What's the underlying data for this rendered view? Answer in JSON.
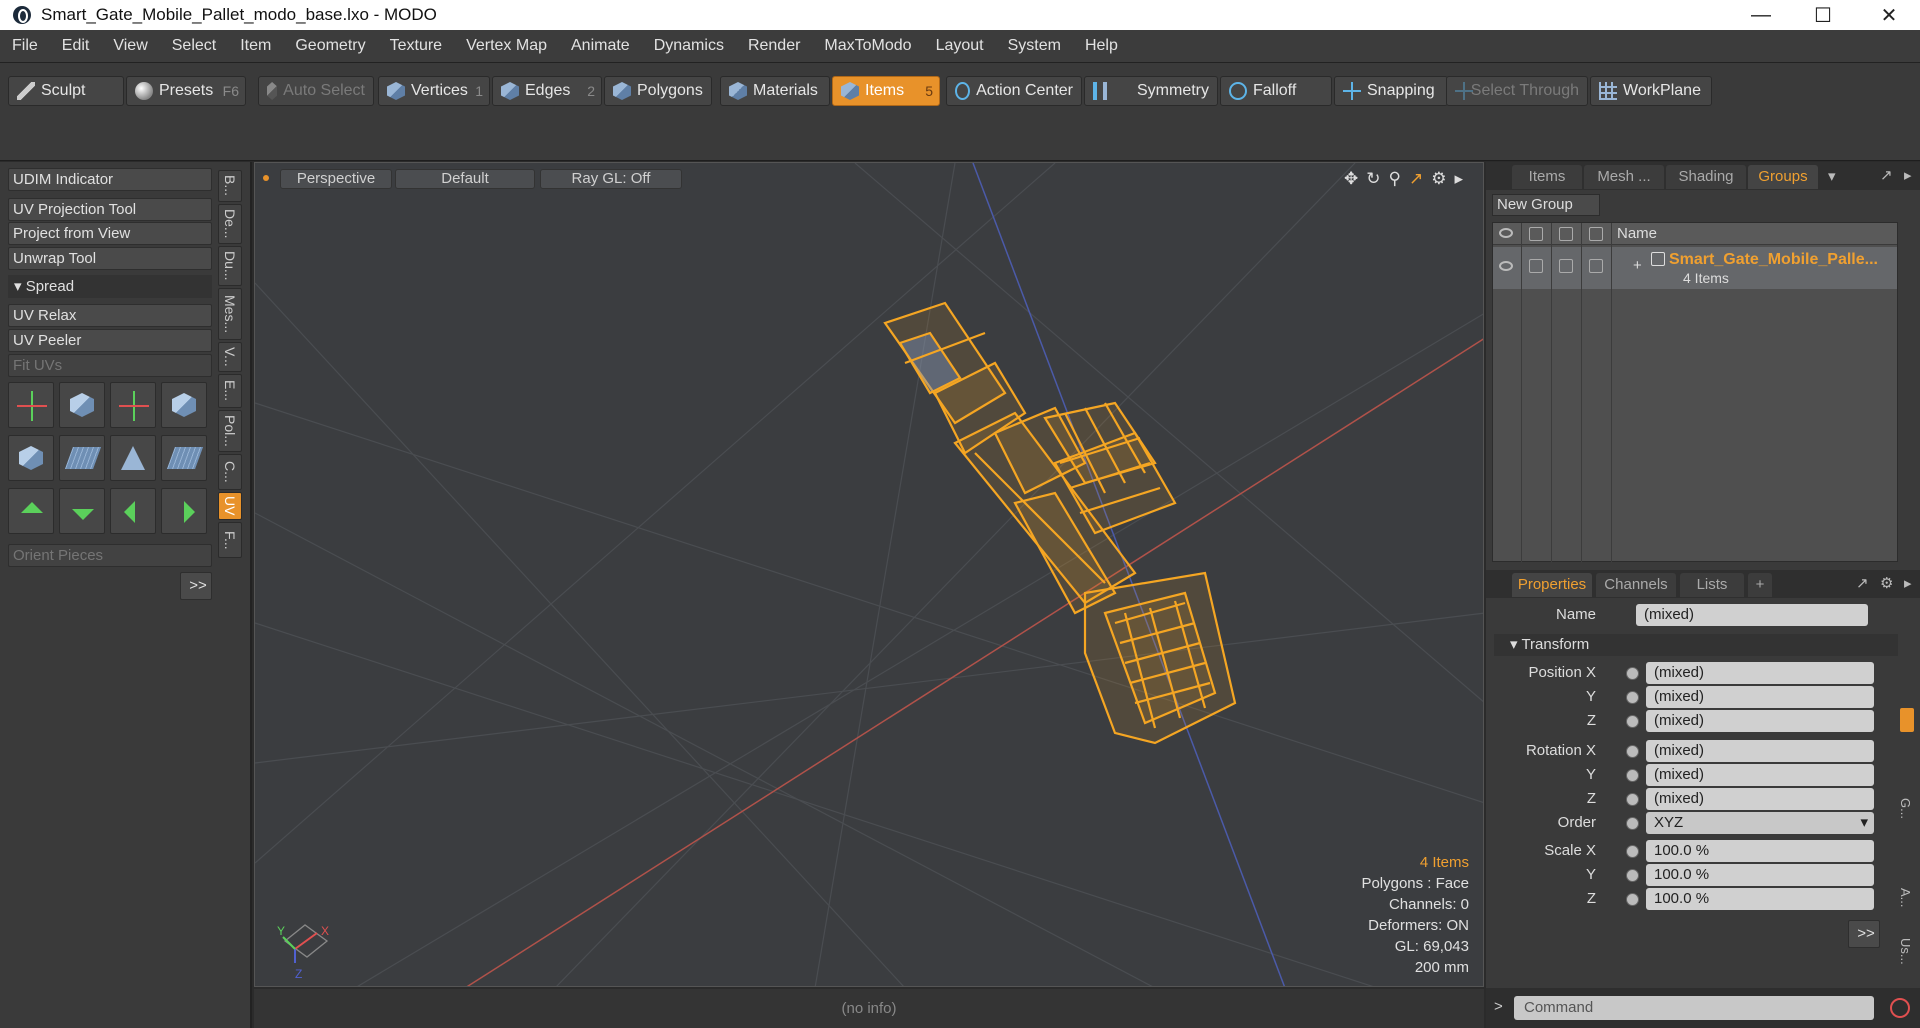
{
  "window": {
    "title": "Smart_Gate_Mobile_Pallet_modo_base.lxo - MODO"
  },
  "menu": [
    "File",
    "Edit",
    "View",
    "Select",
    "Item",
    "Geometry",
    "Texture",
    "Vertex Map",
    "Animate",
    "Dynamics",
    "Render",
    "MaxToModo",
    "Layout",
    "System",
    "Help"
  ],
  "toolbar": {
    "sculpt": "Sculpt",
    "presets": "Presets",
    "presets_key": "F6",
    "auto_select": "Auto Select",
    "vertices": "Vertices",
    "vertices_num": "1",
    "edges": "Edges",
    "edges_num": "2",
    "polygons": "Polygons",
    "materials": "Materials",
    "items": "Items",
    "items_num": "5",
    "action_center": "Action Center",
    "symmetry": "Symmetry",
    "falloff": "Falloff",
    "snapping": "Snapping",
    "select_through": "Select Through",
    "workplane": "WorkPlane"
  },
  "left": {
    "udim": "UDIM Indicator",
    "uv_projection": "UV Projection Tool",
    "project_from_view": "Project from View",
    "unwrap": "Unwrap Tool",
    "spread": "Spread",
    "uv_relax": "UV Relax",
    "uv_peeler": "UV Peeler",
    "fit_uvs": "Fit UVs",
    "orient_pieces": "Orient Pieces",
    "more": ">>",
    "vtabs": [
      "B...",
      "De...",
      "Du...",
      "Mes...",
      "V...",
      "E...",
      "Pol...",
      "C...",
      "UV",
      "F..."
    ]
  },
  "viewport": {
    "view": "Perspective",
    "shading": "Default",
    "raygl": "Ray GL: Off",
    "info_items": "4 Items",
    "info_polygons": "Polygons : Face",
    "info_channels": "Channels: 0",
    "info_deformers": "Deformers: ON",
    "info_gl": "GL: 69,043",
    "info_scale": "200 mm",
    "status": "(no info)"
  },
  "right": {
    "tabs": [
      "Items",
      "Mesh ...",
      "Shading",
      "Groups"
    ],
    "new_group": "New Group",
    "col_name": "Name",
    "group_name": "Smart_Gate_Mobile_Palle...",
    "group_sub": "4 Items",
    "ptabs": [
      "Properties",
      "Channels",
      "Lists",
      "+"
    ],
    "name_label": "Name",
    "name_value": "(mixed)",
    "transform": "Transform",
    "pos_x": "Position X",
    "y": "Y",
    "z": "Z",
    "rot_x": "Rotation X",
    "order": "Order",
    "order_value": "XYZ",
    "scale_x": "Scale X",
    "mixed": "(mixed)",
    "scale_val": "100.0 %",
    "more": ">>",
    "command": "Command",
    "side_tabs": [
      "G...",
      "A...",
      "Us..."
    ]
  },
  "colors": {
    "accent": "#e8922a",
    "mesh": "#f5a623"
  }
}
